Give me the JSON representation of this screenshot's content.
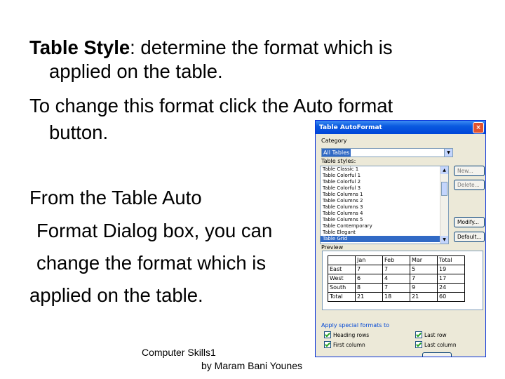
{
  "slide": {
    "line1_bold": "Table Style",
    "line1_rest": ": determine the format which is",
    "line2": "applied on the table.",
    "line3": "To change this format click the Auto format",
    "line4": "button.",
    "para2_line1": "From the Table Auto",
    "para2_line2": "Format Dialog box, you can",
    "para2_line3": "change the format which is",
    "para2_line4": "applied on the table."
  },
  "footer": {
    "line1": "Computer Skills1",
    "line2": "by Maram Bani Younes"
  },
  "dialog": {
    "title": "Table AutoFormat",
    "close_glyph": "×",
    "category_label": "Category",
    "category_value": "All Tables",
    "styles_label": "Table styles:",
    "styles": [
      "Table Classic 1",
      "Table Colorful 1",
      "Table Colorful 2",
      "Table Colorful 3",
      "Table Columns 1",
      "Table Columns 2",
      "Table Columns 3",
      "Table Columns 4",
      "Table Columns 5",
      "Table Contemporary",
      "Table Elegant",
      "Table Grid"
    ],
    "selected_style_index": 11,
    "buttons": {
      "new": "New...",
      "delete": "Delete...",
      "modify": "Modify...",
      "default": "Default..."
    },
    "preview_label": "Preview",
    "preview_table": [
      [
        "",
        "Jan",
        "Feb",
        "Mar",
        "Total"
      ],
      [
        "East",
        "7",
        "7",
        "5",
        "19"
      ],
      [
        "West",
        "6",
        "4",
        "7",
        "17"
      ],
      [
        "South",
        "8",
        "7",
        "9",
        "24"
      ],
      [
        "Total",
        "21",
        "18",
        "21",
        "60"
      ]
    ],
    "apply_label": "Apply special formats to",
    "checkboxes": {
      "heading_rows": "Heading rows",
      "first_column": "First column",
      "last_row": "Last row",
      "last_column": "Last column"
    },
    "arrow_down": "▼",
    "arrow_up": "▲"
  }
}
